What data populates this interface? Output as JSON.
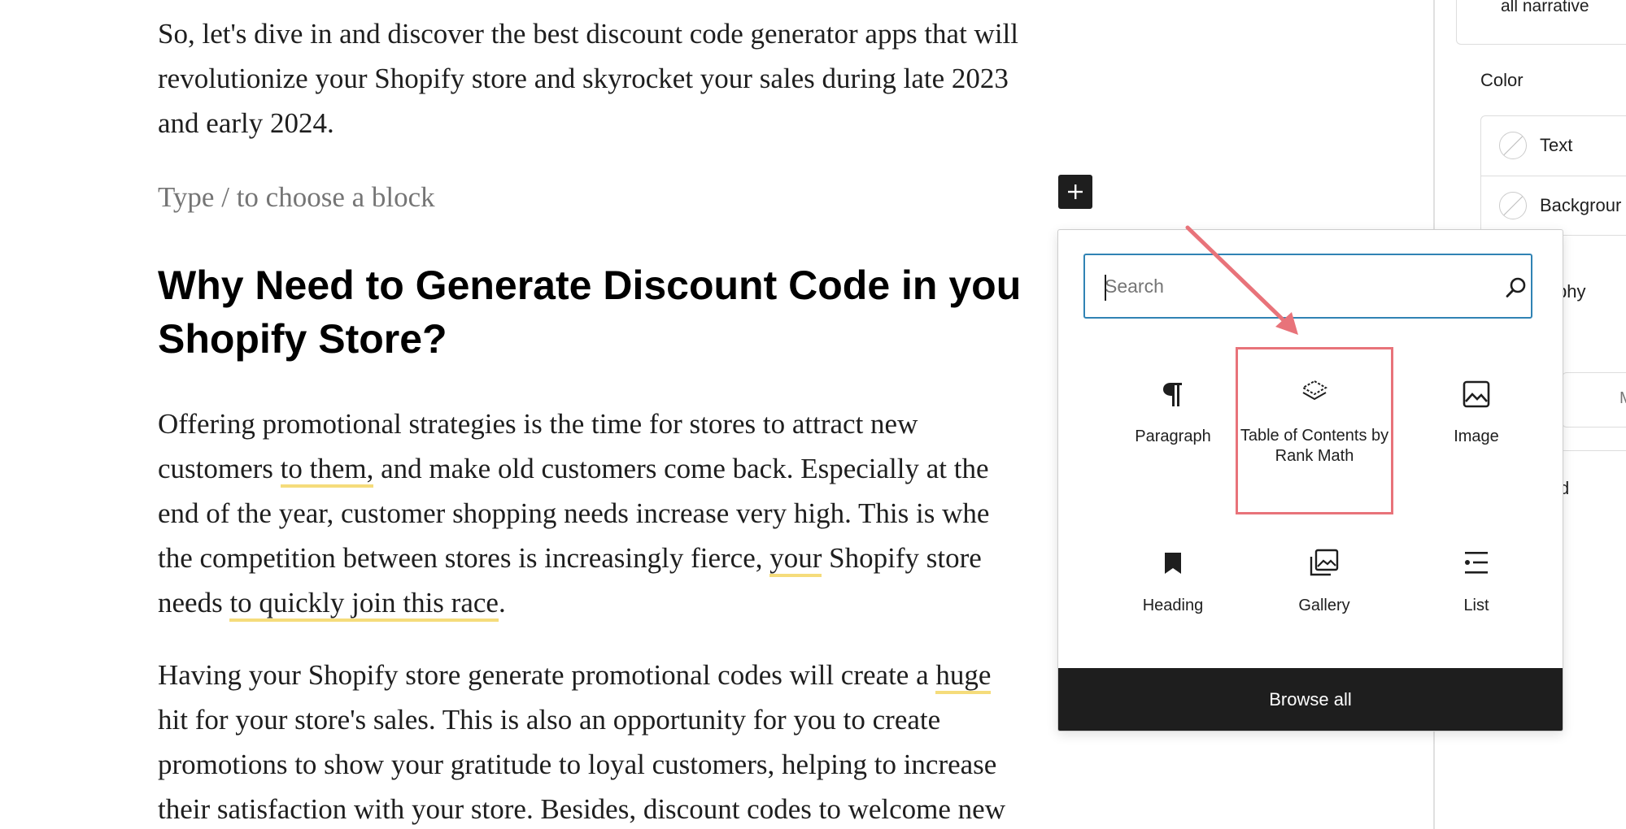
{
  "editor": {
    "intro_lines": [
      "So, let's dive in and discover the best discount code generator apps that will",
      "revolutionize your Shopify store and skyrocket your sales during late 2023",
      "and early 2024."
    ],
    "placeholder": "Type / to choose a block",
    "heading_lines": [
      "Why Need to Generate Discount Code in you",
      "Shopify Store?"
    ],
    "para2": {
      "l1": "Offering promotional strategies is the time for stores to attract new",
      "l2_a": "customers ",
      "l2_hl": "to them,",
      "l2_b": " and make old customers come back. Especially at the",
      "l3": "end of the year, customer shopping needs increase very high. This is whe",
      "l4_a": "the competition between stores is increasingly fierce, ",
      "l4_hl": "your",
      "l4_b": " Shopify store",
      "l5_a": "needs ",
      "l5_hl": "to quickly join this race",
      "l5_b": "."
    },
    "para3": {
      "l1_a": "Having your Shopify store generate promotional codes will create a ",
      "l1_hl": "huge",
      "l2": "hit for your store's sales. This is also an opportunity for you to create",
      "l3": "promotions to show your gratitude to loyal customers, helping to increase",
      "l4": "their satisfaction with your store. Besides, discount codes to welcome new"
    }
  },
  "sidebar": {
    "top_text": "all narrative",
    "color_heading": "Color",
    "color_items": [
      "Text",
      "Backgrour"
    ],
    "typography_partial": "phy",
    "box_partial": "M",
    "d_partial": "d"
  },
  "inserter": {
    "search_placeholder": "Search",
    "blocks": [
      {
        "label": "Paragraph",
        "icon": "paragraph-icon"
      },
      {
        "label": "Table of Contents by Rank Math",
        "icon": "table-of-contents-icon"
      },
      {
        "label": "Image",
        "icon": "image-icon"
      },
      {
        "label": "Heading",
        "icon": "heading-bookmark-icon"
      },
      {
        "label": "Gallery",
        "icon": "gallery-icon"
      },
      {
        "label": "List",
        "icon": "list-icon"
      }
    ],
    "browse_all": "Browse all"
  },
  "colors": {
    "accent": "#3083b4",
    "highlight_box": "#e8737a",
    "underline": "#f5dc7b",
    "dark": "#1e1e1e"
  }
}
